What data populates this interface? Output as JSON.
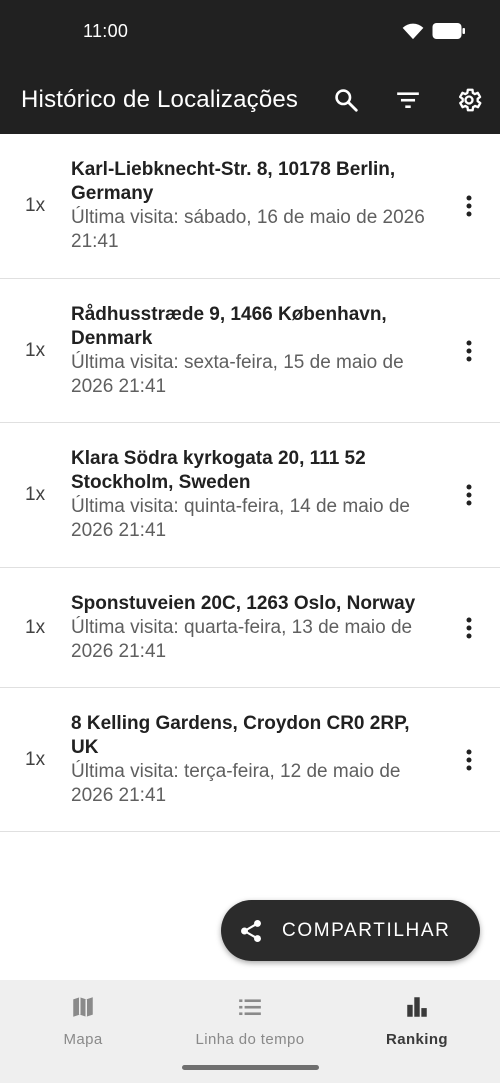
{
  "status": {
    "time": "11:00"
  },
  "app_bar": {
    "title": "Histórico de Localizações",
    "actions": [
      "search-icon",
      "filter-icon",
      "gear-icon"
    ]
  },
  "locations": [
    {
      "count": "1x",
      "address": "Karl-Liebknecht-Str. 8, 10178 Berlin, Germany",
      "last_visit": "Última visita: sábado, 16 de maio de 2026 21:41"
    },
    {
      "count": "1x",
      "address": "Rådhusstræde 9, 1466 København, Denmark",
      "last_visit": "Última visita: sexta-feira, 15 de maio de 2026 21:41"
    },
    {
      "count": "1x",
      "address": "Klara Södra kyrkogata 20, 111 52 Stockholm, Sweden",
      "last_visit": "Última visita: quinta-feira, 14 de maio de 2026 21:41"
    },
    {
      "count": "1x",
      "address": "Sponstuveien 20C, 1263 Oslo, Norway",
      "last_visit": "Última visita: quarta-feira, 13 de maio de 2026 21:41"
    },
    {
      "count": "1x",
      "address": "8 Kelling Gardens, Croydon CR0 2RP, UK",
      "last_visit": "Última visita: terça-feira, 12 de maio de 2026 21:41"
    }
  ],
  "fab": {
    "label": "COMPARTILHAR",
    "icon": "share-icon"
  },
  "bottom_nav": {
    "items": [
      {
        "label": "Mapa",
        "icon": "map-icon"
      },
      {
        "label": "Linha do tempo",
        "icon": "list-icon"
      },
      {
        "label": "Ranking",
        "icon": "bar-chart-icon"
      }
    ],
    "selected": "Ranking"
  }
}
